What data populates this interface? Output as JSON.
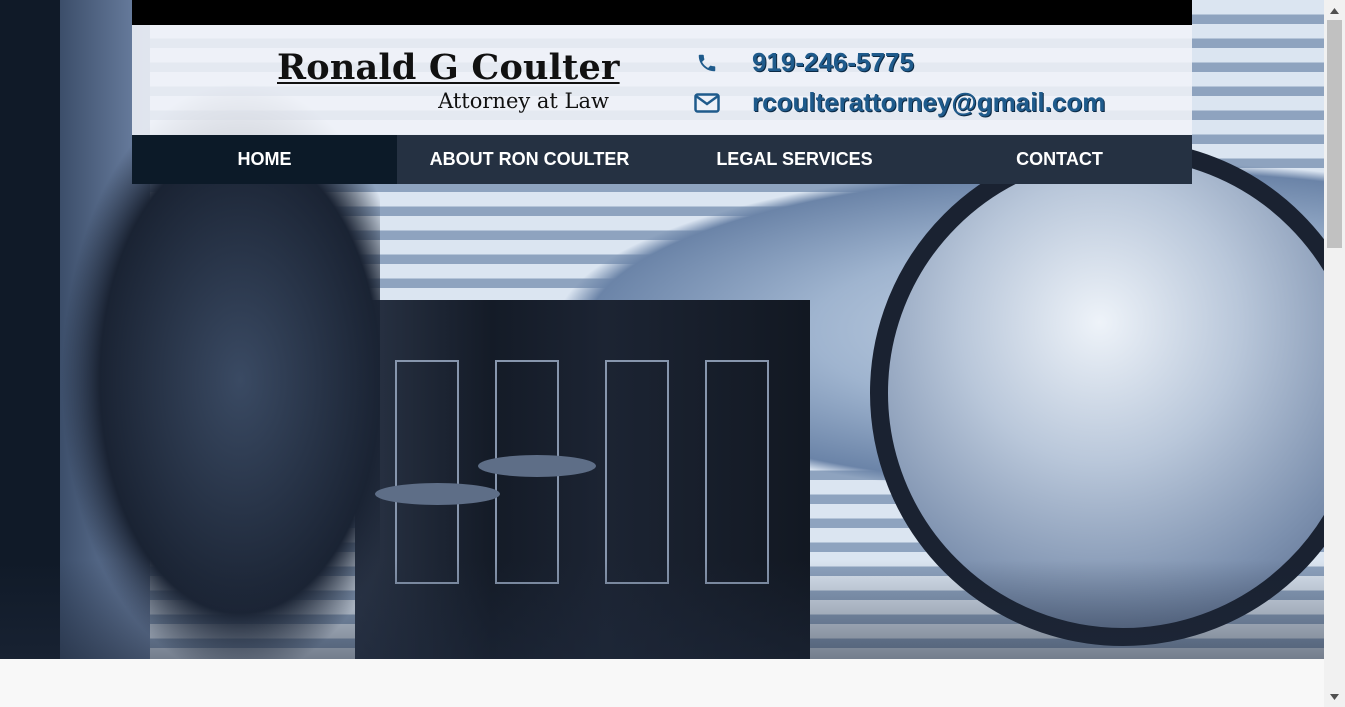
{
  "header": {
    "name": "Ronald G Coulter",
    "tagline": "Attorney at Law",
    "phone": "919-246-5775",
    "email": "rcoulterattorney@gmail.com",
    "phone_icon": "phone-icon",
    "email_icon": "envelope-icon"
  },
  "nav": {
    "items": [
      {
        "label": "HOME",
        "active": true
      },
      {
        "label": "ABOUT RON COULTER",
        "active": false
      },
      {
        "label": "LEGAL SERVICES",
        "active": false
      },
      {
        "label": "CONTACT",
        "active": false
      }
    ]
  },
  "hero": {
    "image": "lady-justice-statue-law-books-globe-photo"
  },
  "colors": {
    "accent": "#1f5b8c",
    "nav_bg": "#253142",
    "nav_active_bg": "#0c1a28",
    "topbar": "#000000"
  }
}
